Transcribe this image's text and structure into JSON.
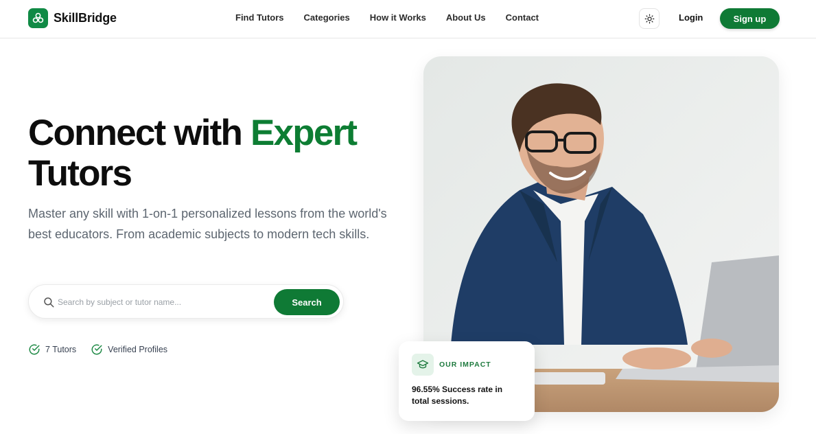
{
  "brand": {
    "name": "SkillBridge",
    "accent": "#0f7a35"
  },
  "nav": {
    "items": [
      {
        "label": "Find Tutors"
      },
      {
        "label": "Categories"
      },
      {
        "label": "How it Works"
      },
      {
        "label": "About Us"
      },
      {
        "label": "Contact"
      }
    ],
    "login_label": "Login",
    "signup_label": "Sign up",
    "theme_icon": "sun-icon"
  },
  "hero": {
    "title_part1": "Connect with ",
    "title_accent": "Expert",
    "title_part2": "Tutors",
    "subtitle": "Master any skill with 1-on-1 personalized lessons from the world's best educators. From academic subjects to modern tech skills.",
    "search": {
      "placeholder": "Search by subject or tutor name...",
      "value": "",
      "button_label": "Search"
    },
    "badges": [
      {
        "icon": "check-circle-icon",
        "label": "7 Tutors"
      },
      {
        "icon": "check-circle-icon",
        "label": "Verified Profiles"
      }
    ]
  },
  "impact": {
    "icon": "graduation-cap-icon",
    "label": "OUR IMPACT",
    "text": "96.55% Success rate in total sessions."
  }
}
